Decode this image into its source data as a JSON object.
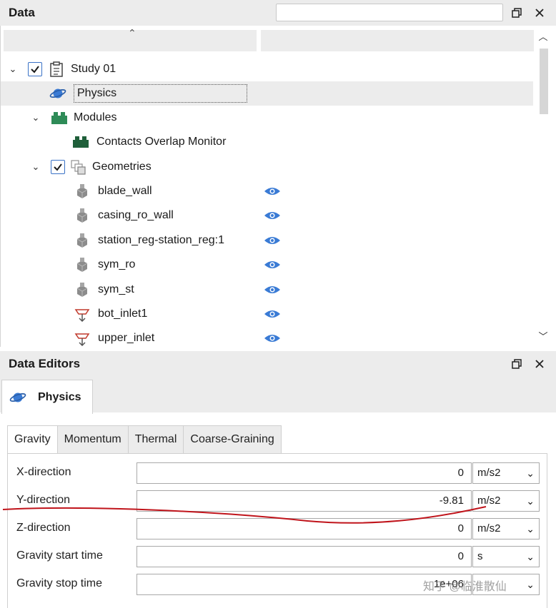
{
  "data_panel": {
    "title": "Data",
    "search": {
      "value": "",
      "placeholder": ""
    },
    "tree": [
      {
        "label": "Study 01",
        "level": 0,
        "expanded": true,
        "checked": true,
        "icon": "clipboard-icon"
      },
      {
        "label": "Physics",
        "level": 1,
        "selected": true,
        "icon": "planet-icon"
      },
      {
        "label": "Modules",
        "level": 1,
        "expanded": true,
        "icon": "modules-icon"
      },
      {
        "label": "Contacts Overlap Monitor",
        "level": 2,
        "icon": "module-block-icon"
      },
      {
        "label": "Geometries",
        "level": 1,
        "expanded": true,
        "checked": true,
        "icon": "geometries-icon"
      },
      {
        "label": "blade_wall",
        "level": 2,
        "icon": "geometry-cube-icon",
        "visible": true
      },
      {
        "label": "casing_ro_wall",
        "level": 2,
        "icon": "geometry-cube-icon",
        "visible": true
      },
      {
        "label": "station_reg-station_reg:1",
        "level": 2,
        "icon": "geometry-cube-icon",
        "visible": true
      },
      {
        "label": "sym_ro",
        "level": 2,
        "icon": "geometry-cube-icon",
        "visible": true
      },
      {
        "label": "sym_st",
        "level": 2,
        "icon": "geometry-cube-icon",
        "visible": true
      },
      {
        "label": "bot_inlet1",
        "level": 2,
        "icon": "inlet-icon",
        "visible": true
      },
      {
        "label": "upper_inlet",
        "level": 2,
        "icon": "inlet-icon",
        "visible": true
      }
    ]
  },
  "editors_panel": {
    "title": "Data Editors",
    "tab_label": "Physics",
    "sub_tabs": [
      "Gravity",
      "Momentum",
      "Thermal",
      "Coarse-Graining"
    ],
    "active_sub_tab": "Gravity",
    "properties": [
      {
        "label": "X-direction",
        "value": "0",
        "unit": "m/s2"
      },
      {
        "label": "Y-direction",
        "value": "-9.81",
        "unit": "m/s2"
      },
      {
        "label": "Z-direction",
        "value": "0",
        "unit": "m/s2"
      },
      {
        "label": "Gravity start time",
        "value": "0",
        "unit": "s"
      },
      {
        "label": "Gravity stop time",
        "value": "1e+06",
        "unit": ""
      }
    ]
  },
  "watermark": "知乎 @临淮散仙",
  "colors": {
    "accent": "#3a72c6",
    "eye": "#3a7bd5",
    "module_green": "#2e8b57",
    "annotation_red": "#c0141b"
  }
}
